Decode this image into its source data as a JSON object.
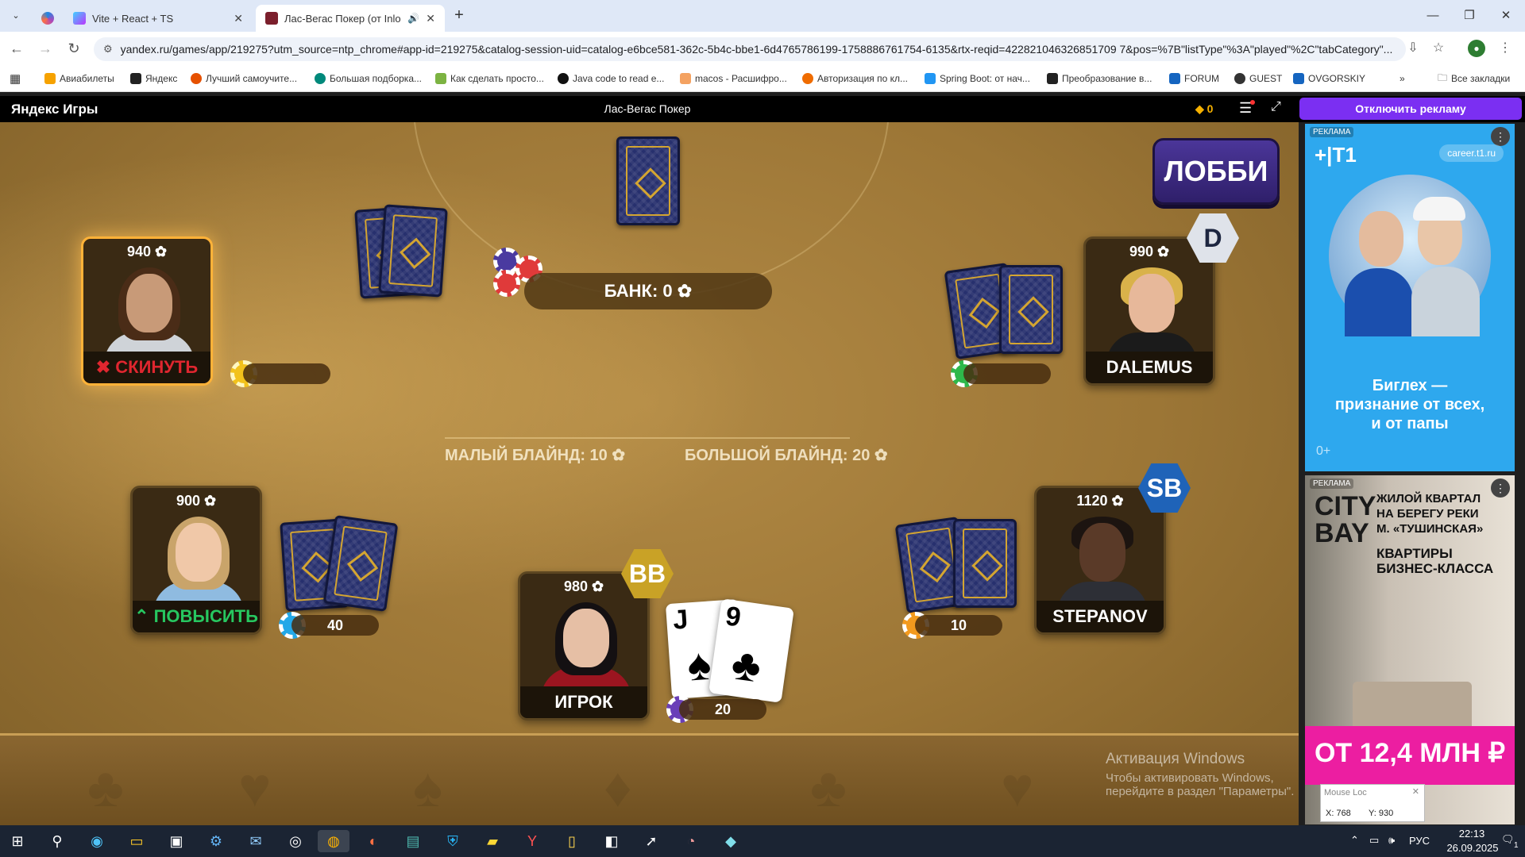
{
  "browser": {
    "tabs": [
      {
        "title": "",
        "icon": "edge-copilot-icon"
      },
      {
        "title": "Vite + React + TS",
        "icon": "vite-icon"
      },
      {
        "title": "Лас-Вегас Покер (от Inlogi",
        "icon": "yandex-games-icon",
        "audio": "speaker-icon",
        "active": true
      }
    ],
    "url": "yandex.ru/games/app/219275?utm_source=ntp_chrome#app-id=219275&catalog-session-uid=catalog-e6bce581-362c-5b4c-bbe1-6d4765786199-1758886761754-6135&rtx-reqid=422821046326851709 7&pos=%7B\"listType\"%3A\"played\"%2C\"tabCategory\"...",
    "bookmarks": [
      "Авиабилеты",
      "Яндекс",
      "Лучший самоучите...",
      "Большая подборка...",
      "Как сделать просто...",
      "Java code to read e...",
      "macos - Расшифро...",
      "Авторизация по кл...",
      "Spring Boot: от нач...",
      "Преобразование в...",
      "FORUM",
      "GUEST",
      "OVGORSKIY"
    ],
    "all_bookmarks": "Все закладки"
  },
  "yandex_header": {
    "logo": "Яндекс Игры",
    "game_title": "Лас-Вегас Покер",
    "coins": "0",
    "disable_ads": "Отключить рекламу"
  },
  "game": {
    "lobby_button": "ЛОББИ ➔",
    "bank": "БАНК: 0 ✿",
    "small_blind": "МАЛЫЙ БЛАЙНД: 10 ✿",
    "big_blind": "БОЛЬШОЙ БЛАЙНД: 20 ✿",
    "players": {
      "top_left": {
        "chips": "940 ✿",
        "action": "✖ СКИНУТЬ",
        "bet": ""
      },
      "top_right": {
        "chips": "990 ✿",
        "name": "DALEMUS",
        "bet": "",
        "badge": "D"
      },
      "bottom_left": {
        "chips": "900 ✿",
        "action": "⌃ ПОВЫСИТЬ",
        "bet": "40"
      },
      "bottom_right": {
        "chips": "1120 ✿",
        "name": "STEPANOV",
        "bet": "10",
        "badge": "SB"
      },
      "hero": {
        "chips": "980 ✿",
        "name": "ИГРОК",
        "bet": "20",
        "badge": "BB"
      }
    },
    "hero_cards": [
      {
        "rank": "J",
        "suit": "♠"
      },
      {
        "rank": "9",
        "suit": "♣"
      }
    ],
    "colors": {
      "highlight": "#ffb238",
      "fold_red": "#e0262f",
      "raise_green": "#27c760"
    }
  },
  "watermark": {
    "title": "Активация Windows",
    "subtitle": "Чтобы активировать Windows, перейдите в раздел \"Параметры\"."
  },
  "ads": {
    "ad1": {
      "label": "РЕКЛАМА",
      "brand": "+|T1",
      "url": "career.t1.ru",
      "headline": "Биглех — признание от всех, и от папы",
      "age": "0+"
    },
    "ad2": {
      "label": "РЕКЛАМА",
      "brand": "CITY BAY",
      "line1": "ЖИЛОЙ КВАРТАЛ",
      "line2": "НА БЕРЕГУ РЕКИ",
      "line3": "М. «ТУШИНСКАЯ»",
      "line4": "КВАРТИРЫ",
      "line5": "БИЗНЕС-КЛАССА",
      "price": "ОТ 12,4 МЛН ₽"
    }
  },
  "mouse_loc": {
    "title": "Mouse Loc",
    "x": "X: 768",
    "y": "Y: 930"
  },
  "taskbar": {
    "lang": "РУС",
    "time": "22:13",
    "date": "26.09.2025",
    "notif": "1"
  }
}
